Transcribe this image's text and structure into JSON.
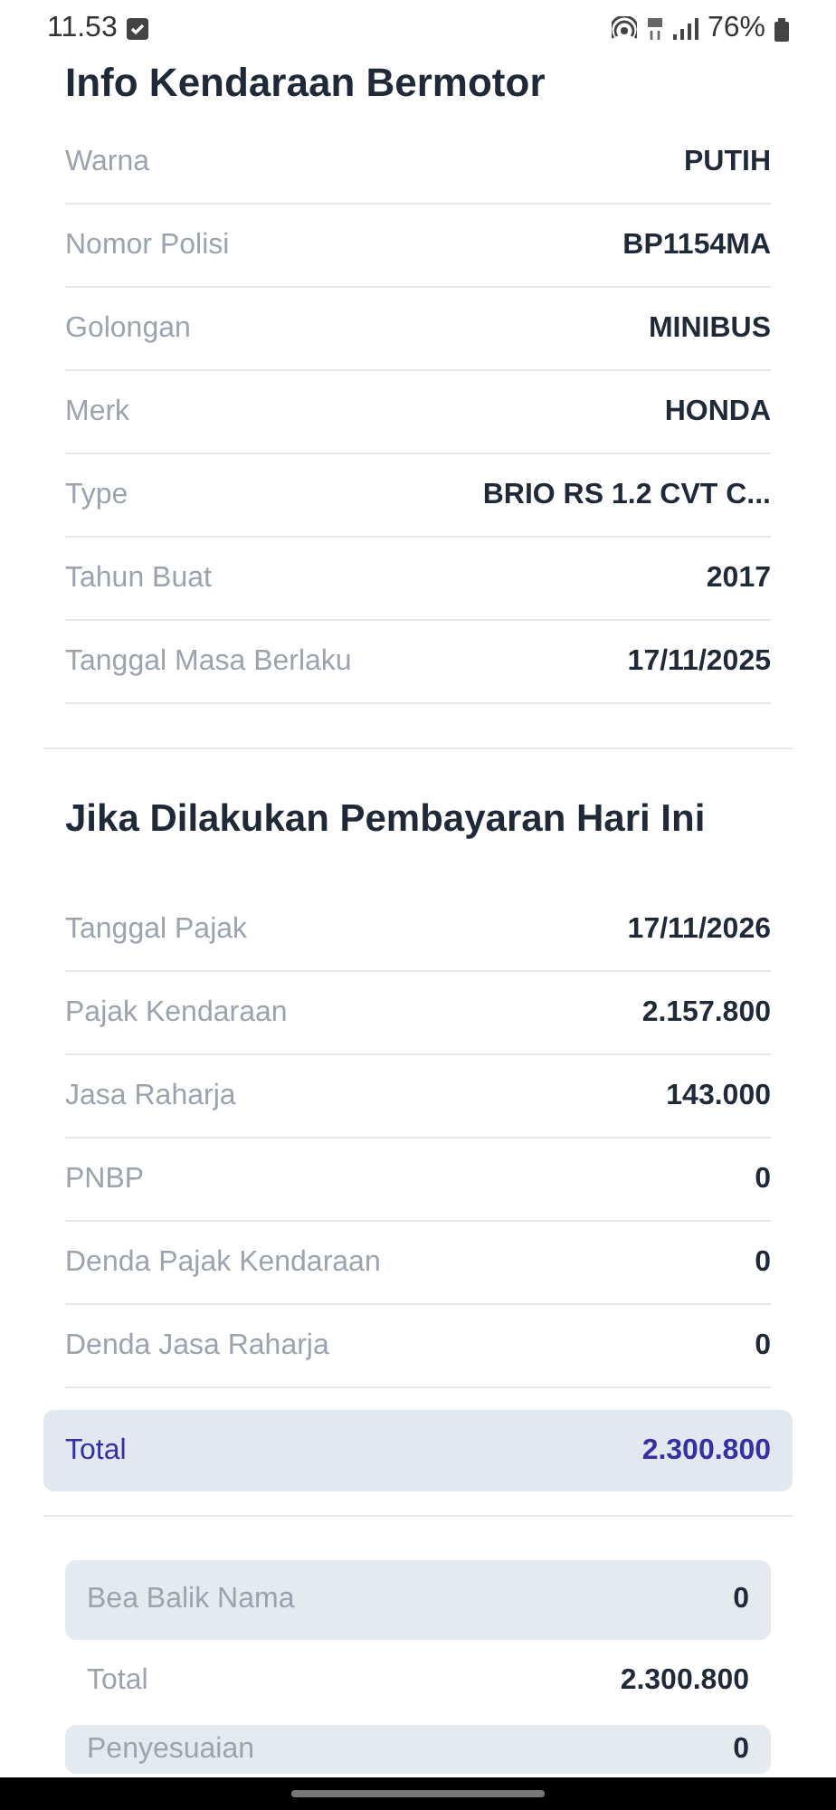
{
  "status_bar": {
    "time": "11.53",
    "battery": "76%"
  },
  "vehicle_info": {
    "title": "Info Kendaraan Bermotor",
    "rows": [
      {
        "label": "Warna",
        "value": "PUTIH"
      },
      {
        "label": "Nomor Polisi",
        "value": "BP1154MA"
      },
      {
        "label": "Golongan",
        "value": "MINIBUS"
      },
      {
        "label": "Merk",
        "value": "HONDA"
      },
      {
        "label": "Type",
        "value": "BRIO RS 1.2 CVT C..."
      },
      {
        "label": "Tahun Buat",
        "value": "2017"
      },
      {
        "label": "Tanggal Masa Berlaku",
        "value": "17/11/2025"
      }
    ]
  },
  "payment": {
    "title": "Jika Dilakukan Pembayaran Hari Ini",
    "rows": [
      {
        "label": "Tanggal Pajak",
        "value": "17/11/2026"
      },
      {
        "label": "Pajak Kendaraan",
        "value": "2.157.800"
      },
      {
        "label": "Jasa Raharja",
        "value": "143.000"
      },
      {
        "label": "PNBP",
        "value": "0"
      },
      {
        "label": "Denda Pajak Kendaraan",
        "value": "0"
      },
      {
        "label": "Denda Jasa Raharja",
        "value": "0"
      }
    ],
    "total": {
      "label": "Total",
      "value": "2.300.800"
    }
  },
  "extra": [
    {
      "kind": "box",
      "label": "Bea Balik Nama",
      "value": "0"
    },
    {
      "kind": "row",
      "label": "Total",
      "value": "2.300.800"
    },
    {
      "kind": "box",
      "label": "Penyesuaian",
      "value": "0"
    }
  ]
}
